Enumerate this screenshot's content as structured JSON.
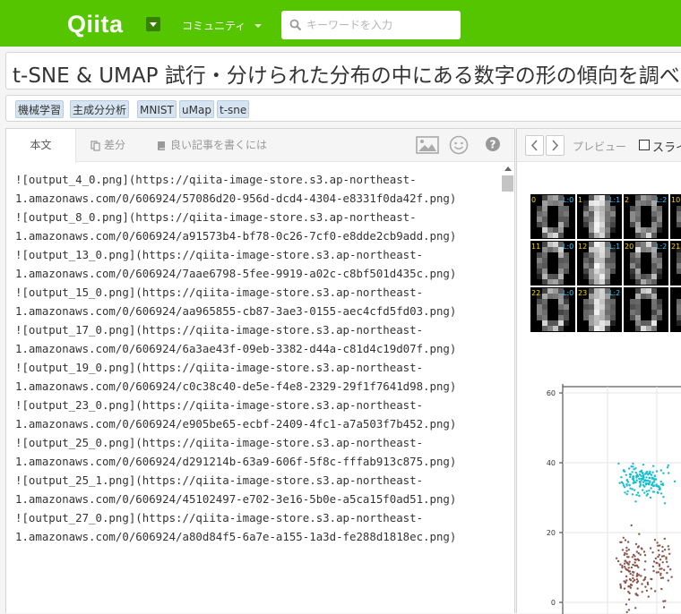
{
  "header": {
    "logo": "Qiita",
    "community": "コミュニティ",
    "search_placeholder": "キーワードを入力"
  },
  "article": {
    "title": "t-SNE & UMAP 試行・分けられた分布の中にある数字の形の傾向を調べ",
    "tags": [
      "機械学習",
      "主成分分析",
      "MNIST",
      "uMap",
      "t-sne"
    ]
  },
  "editor": {
    "tabs": {
      "body": "本文",
      "diff": "差分",
      "guide": "良い記事を書くには"
    },
    "lines": [
      "![output_4_0.png](https://qiita-image-store.s3.ap-northeast-",
      "1.amazonaws.com/0/606924/57086d20-956d-dcd4-4304-e8331f0da42f.png)",
      "![output_8_0.png](https://qiita-image-store.s3.ap-northeast-",
      "1.amazonaws.com/0/606924/a91573b4-bf78-0c26-7cf0-e8dde2cb9add.png)",
      "![output_13_0.png](https://qiita-image-store.s3.ap-northeast-",
      "1.amazonaws.com/0/606924/7aae6798-5fee-9919-a02c-c8bf501d435c.png)",
      "![output_15_0.png](https://qiita-image-store.s3.ap-northeast-",
      "1.amazonaws.com/0/606924/aa965855-cb87-3ae3-0155-aec4cfd5fd03.png)",
      "![output_17_0.png](https://qiita-image-store.s3.ap-northeast-",
      "1.amazonaws.com/0/606924/6a3ae43f-09eb-3382-d44a-c81d4c19d07f.png)",
      "![output_19_0.png](https://qiita-image-store.s3.ap-northeast-",
      "1.amazonaws.com/0/606924/c0c38c40-de5e-f4e8-2329-29f1f7641d98.png)",
      "![output_23_0.png](https://qiita-image-store.s3.ap-northeast-",
      "1.amazonaws.com/0/606924/e905be65-ecbf-2409-4fc1-a7a503f7b452.png)",
      "![output_25_0.png](https://qiita-image-store.s3.ap-northeast-",
      "1.amazonaws.com/0/606924/d291214b-63a9-606f-5f8c-fffab913c875.png)",
      "![output_25_1.png](https://qiita-image-store.s3.ap-northeast-",
      "1.amazonaws.com/0/606924/45102497-e702-3e16-5b0e-a5ca15f0ad51.png)",
      "![output_27_0.png](https://qiita-image-store.s3.ap-northeast-",
      "1.amazonaws.com/0/606924/a80d84f5-6a7e-a155-1a3d-fe288d1818ec.png)"
    ]
  },
  "preview": {
    "label": "プレビュー",
    "scroll_label": "スライ",
    "digit_grid": {
      "index_labels": [
        "0",
        "1",
        "2",
        "10",
        "11",
        "12",
        "20",
        "21",
        "22",
        "23"
      ],
      "class_labels": [
        "L:0",
        "L:1",
        "L:2",
        "L:0",
        "L:1",
        "L:2",
        "L:0",
        "L:2"
      ]
    },
    "scatter_yticks": [
      "60",
      "40",
      "20",
      "0"
    ]
  },
  "colors": {
    "brand": "#55c500",
    "cyan_cluster": "#17becf",
    "brown_cluster": "#8c564b"
  }
}
